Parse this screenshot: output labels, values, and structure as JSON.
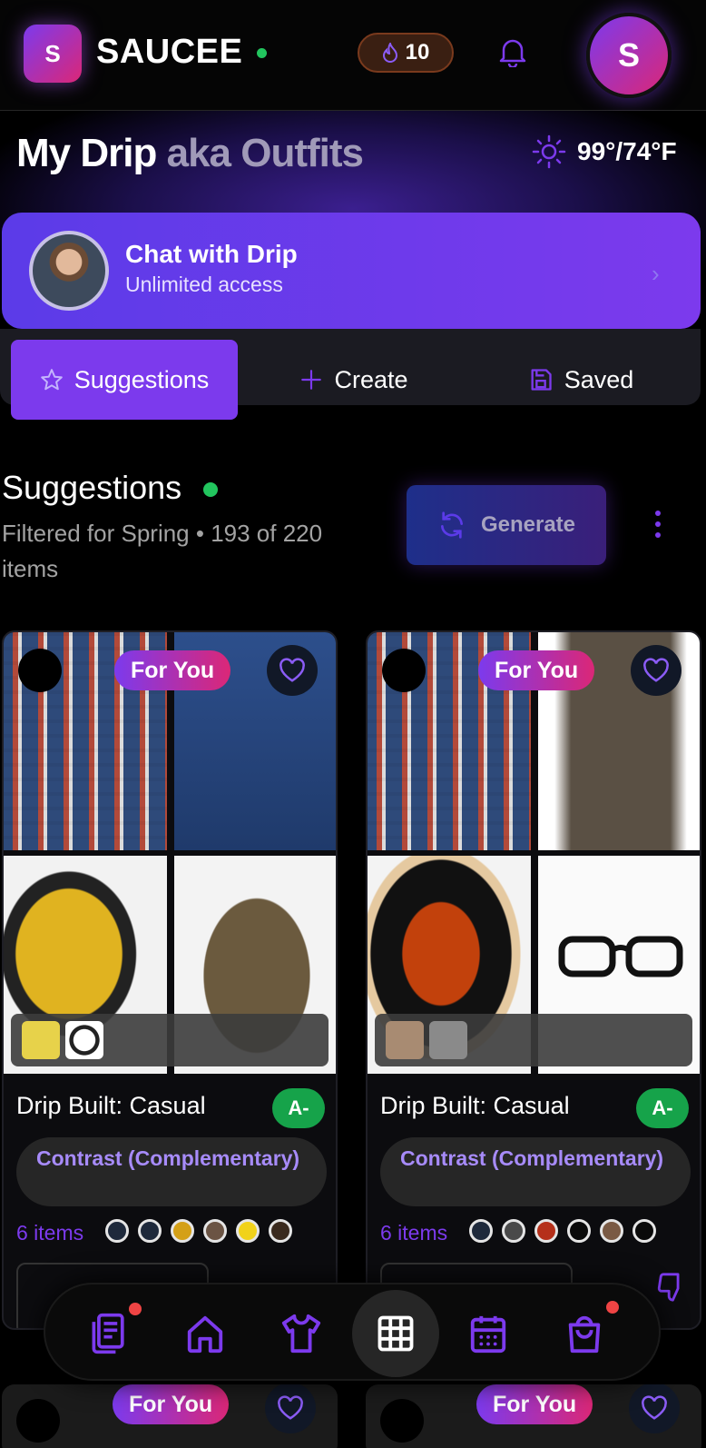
{
  "header": {
    "logo_letter": "S",
    "brand": "SAUCEE",
    "streak_count": "10",
    "avatar_letter": "S"
  },
  "hero": {
    "title_main": "My Drip",
    "title_sub": "aka Outfits",
    "weather": "99°/74°F"
  },
  "chat": {
    "title": "Chat with Drip",
    "subtitle": "Unlimited access"
  },
  "tabs": [
    {
      "label": "Suggestions",
      "icon": "star-icon",
      "active": true
    },
    {
      "label": "Create",
      "icon": "plus-icon",
      "active": false
    },
    {
      "label": "Saved",
      "icon": "save-icon",
      "active": false
    }
  ],
  "suggestions": {
    "title": "Suggestions",
    "subtitle": "Filtered for Spring • 193 of 220 items",
    "generate_label": "Generate"
  },
  "cards": [
    {
      "badge": "For You",
      "title": "Drip Built: Casual",
      "grade": "A-",
      "harmony": "Contrast (Complementary)",
      "items_label": "6 items",
      "swatches": [
        "#1e293b",
        "#1e293b",
        "#d4a017",
        "#6b5444",
        "#f1d21a",
        "#3a2a1e"
      ],
      "images": [
        "plaid-shirt",
        "denim-jeans",
        "yellow-sneakers",
        "olive-nike-cap"
      ]
    },
    {
      "badge": "For You",
      "title": "Drip Built: Casual",
      "grade": "A-",
      "harmony": "Contrast (Complementary)",
      "items_label": "6 items",
      "swatches": [
        "#1e293b",
        "#4a4a4a",
        "#b5301a",
        "#0a0a0a",
        "#7a5a44",
        "#0a0a0a"
      ],
      "images": [
        "plaid-shirt",
        "olive-pants",
        "orange-black-high-tops",
        "black-glasses"
      ]
    }
  ],
  "peek": [
    {
      "badge": "For You"
    },
    {
      "badge": "For You"
    }
  ],
  "colors": {
    "accent": "#7c3aed",
    "pink": "#db2777",
    "online": "#22c55e",
    "grade": "#16a34a"
  },
  "nav": [
    "closet-list-icon",
    "home-icon",
    "shirt-icon",
    "grid-icon",
    "calendar-icon",
    "shopping-bag-icon"
  ]
}
